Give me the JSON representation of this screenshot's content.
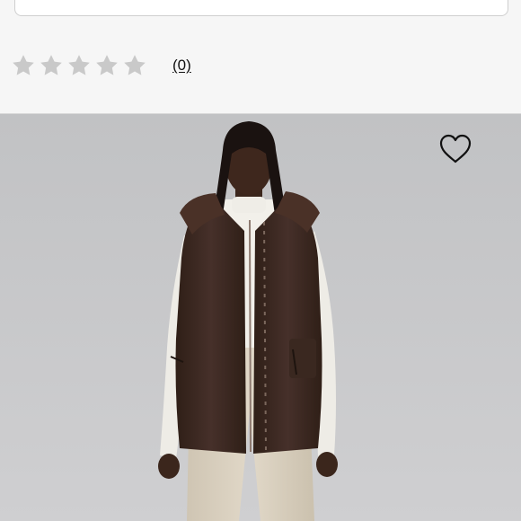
{
  "rating": {
    "stars_total": 5,
    "stars_filled": 0,
    "review_count_label": "(0)"
  },
  "colors": {
    "star_empty": "#c9c9c9",
    "background": "#f6f6f6",
    "image_background": "#c6c7c9",
    "vest": "#3d2a20"
  },
  "icons": {
    "star": "star-icon",
    "wishlist": "heart-outline-icon"
  }
}
